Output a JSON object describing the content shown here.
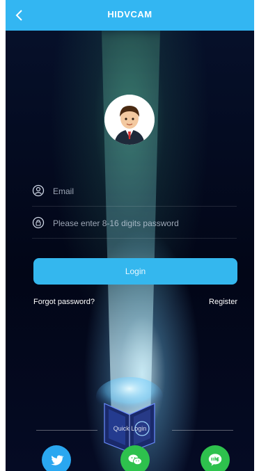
{
  "header": {
    "title": "HIDVCAM",
    "back_icon": "chevron-left-icon"
  },
  "form": {
    "email_placeholder": "Email",
    "password_placeholder": "Please enter 8-16 digits password",
    "login_label": "Login",
    "forgot_label": "Forgot password?",
    "register_label": "Register"
  },
  "quick": {
    "label": "Quick Login",
    "providers": [
      {
        "name": "twitter",
        "icon": "twitter-icon",
        "color": "#2aa7f0"
      },
      {
        "name": "wechat",
        "icon": "wechat-icon",
        "color": "#2ec14d"
      },
      {
        "name": "line",
        "icon": "line-icon",
        "color": "#2ec14d"
      }
    ]
  },
  "colors": {
    "accent": "#33b6f2",
    "background": "#050b1d"
  }
}
